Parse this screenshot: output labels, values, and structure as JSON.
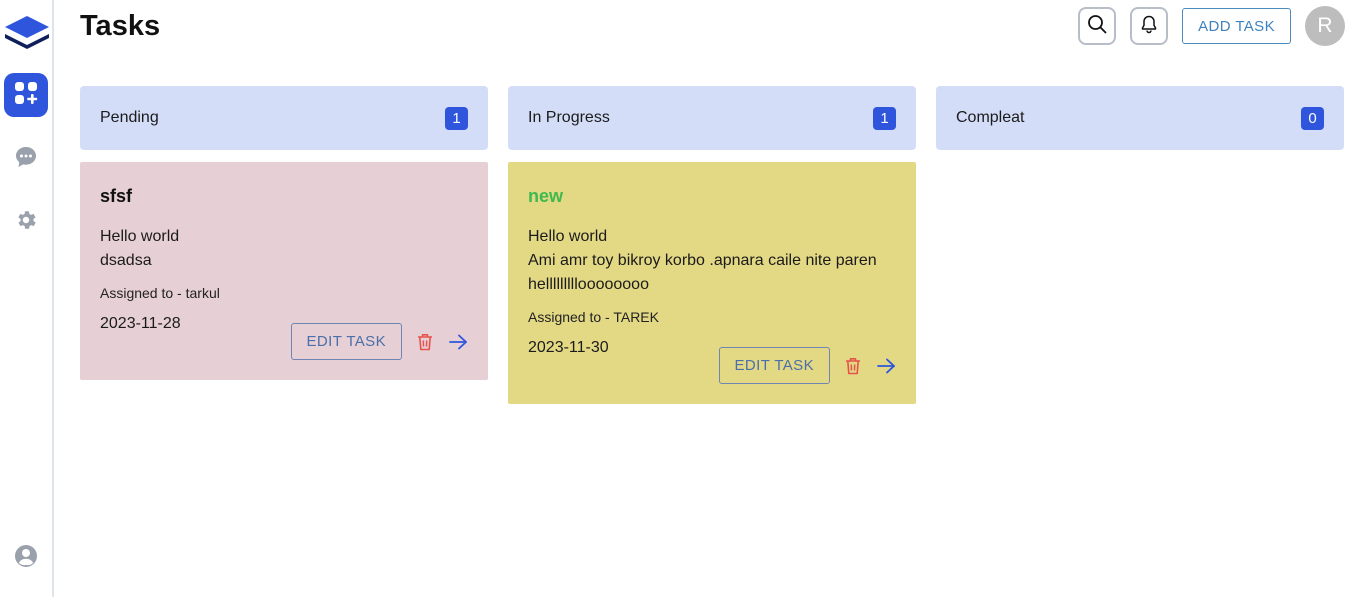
{
  "header": {
    "title": "Tasks",
    "add_task_label": "ADD TASK",
    "avatar_initial": "R"
  },
  "sidebar": {
    "items": [
      {
        "name": "dashboard",
        "active": true
      },
      {
        "name": "messages",
        "active": false
      },
      {
        "name": "settings",
        "active": false
      }
    ]
  },
  "columns": [
    {
      "label": "Pending",
      "count": "1",
      "cards": [
        {
          "title": "sfsf",
          "title_color": "#111111",
          "bg": "#e6cfd5",
          "desc_lines": [
            "Hello world",
            "dsadsa"
          ],
          "assigned": "Assigned to - tarkul",
          "date": "2023-11-28",
          "edit_label": "EDIT TASK"
        }
      ]
    },
    {
      "label": "In Progress",
      "count": "1",
      "cards": [
        {
          "title": "new",
          "title_color": "#3fb950",
          "bg": "#e3d984",
          "desc_lines": [
            "Hello world",
            "Ami amr toy bikroy korbo .apnara caile nite paren",
            "hellllllllloooooooo"
          ],
          "assigned": "Assigned to - TAREK",
          "date": "2023-11-30",
          "edit_label": "EDIT TASK"
        }
      ]
    },
    {
      "label": "Compleat",
      "count": "0",
      "cards": []
    }
  ],
  "colors": {
    "accent": "#2e55dc",
    "delete": "#e5534b",
    "arrow": "#2e55dc"
  }
}
